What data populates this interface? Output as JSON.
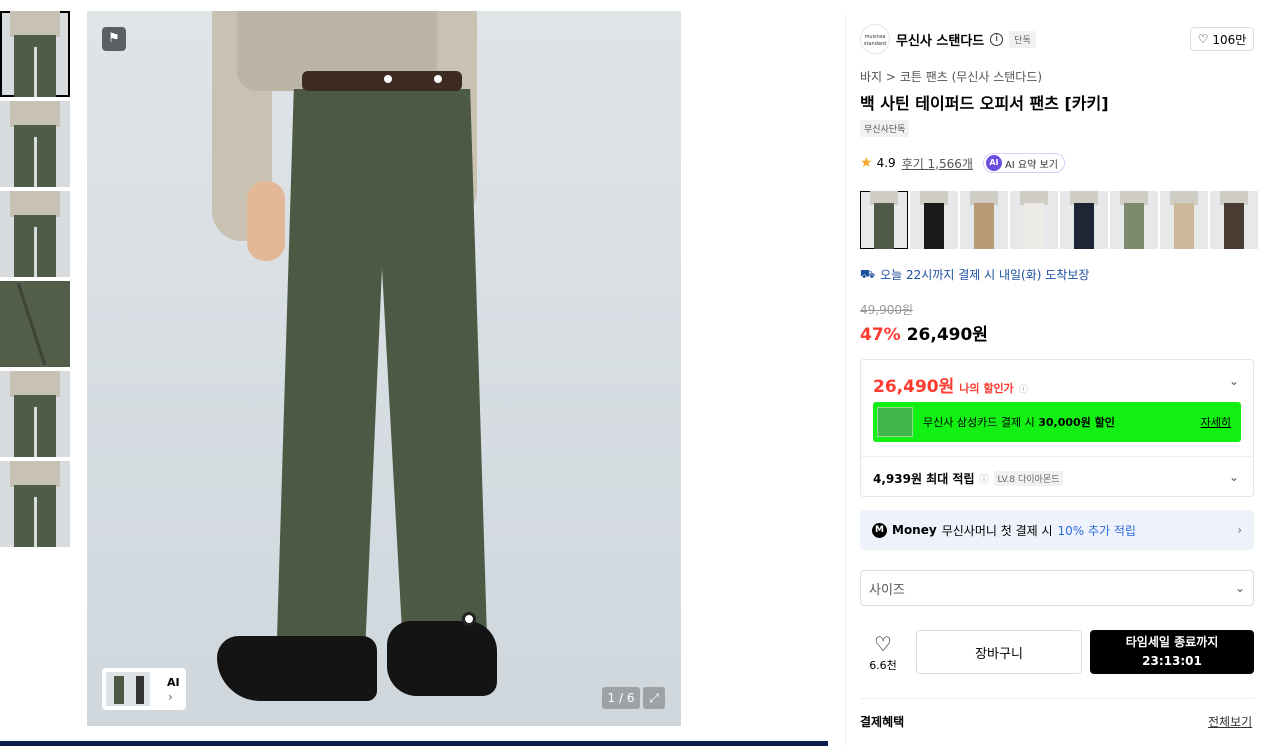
{
  "thumbnails": [
    {
      "kind": "full",
      "active": true
    },
    {
      "kind": "full",
      "active": false
    },
    {
      "kind": "full",
      "active": false
    },
    {
      "kind": "detail",
      "active": false
    },
    {
      "kind": "full",
      "active": false
    },
    {
      "kind": "full",
      "active": false
    }
  ],
  "gallery": {
    "ai_label": "AI",
    "counter": "1 / 6"
  },
  "brand": {
    "logo_text": "musinsa standard",
    "name": "무신사 스탠다드",
    "chip": "단독",
    "likes": "106만"
  },
  "breadcrumb": {
    "category": "바지",
    "separator": ">",
    "subcategory": "코튼 팬츠 (무신사 스탠다드)"
  },
  "product": {
    "title": "백 사틴 테이퍼드 오피서 팬츠 [카키]",
    "exclusive_chip": "무신사단독",
    "rating": "4.9",
    "reviews": "후기 1,566개",
    "ai_summary": "AI 요약 보기",
    "delivery": "오늘 22시까지 결제 시 내일(화) 도착보장",
    "original_price": "49,900원",
    "discount": "47%",
    "price": "26,490원"
  },
  "color_options": [
    {
      "color": "#4f5a47",
      "selected": true
    },
    {
      "color": "#1a1a1a",
      "selected": false
    },
    {
      "color": "#b89b74",
      "selected": false
    },
    {
      "color": "#ecebe5",
      "selected": false
    },
    {
      "color": "#1e2535",
      "selected": false
    },
    {
      "color": "#7e8a6e",
      "selected": false
    },
    {
      "color": "#cdb99a",
      "selected": false
    },
    {
      "color": "#4a3c33",
      "selected": false
    }
  ],
  "benefits": {
    "my_price": "26,490원",
    "my_price_label": "나의 할인가",
    "card_text_pre": "무신사 삼성카드 결제 시",
    "card_amount": "30,000원 할인",
    "card_more": "자세히",
    "points": "4,939원 최대 적립",
    "level": "LV.8 다이아몬드"
  },
  "money": {
    "logo": "M",
    "name": "Money",
    "text": "무신사머니 첫 결제 시",
    "accent": "10% 추가 적립"
  },
  "size_select": {
    "placeholder": "사이즈"
  },
  "actions": {
    "wish_count": "6.6천",
    "cart": "장바구니",
    "buy_line1": "타임세일 종료까지",
    "buy_line2": "23:13:01"
  },
  "payment": {
    "title": "결제혜택",
    "view_all": "전체보기"
  },
  "colors": {
    "discount_red": "#ff3b30",
    "card_green": "#12f014",
    "delivery_blue": "#1d4fa0"
  }
}
